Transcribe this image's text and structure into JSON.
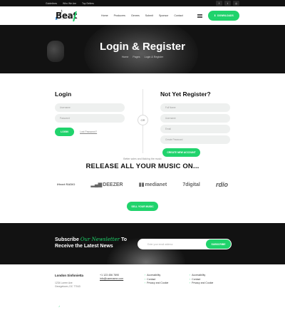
{
  "topbar": {
    "links": [
      "Guidelines",
      "Who We Are",
      "Top Sellers"
    ],
    "login_label": "Login or Register",
    "social": [
      "f",
      "t",
      "◎"
    ]
  },
  "header": {
    "logo_text": "Beat",
    "logo_note": "♪",
    "nav": [
      "Home",
      "Producers",
      "Genres",
      "Submit",
      "Sponsor",
      "Contact"
    ],
    "cta_label": "DOWNLOADS"
  },
  "hero": {
    "title": "Login & Register",
    "crumbs": [
      "Home",
      "Pages",
      "Login & Register"
    ]
  },
  "login": {
    "heading": "Login",
    "username_placeholder": "Username",
    "password_placeholder": "Password",
    "button": "LOGIN",
    "forgot": "Lost Password?"
  },
  "divider": {
    "or": "OR"
  },
  "register": {
    "heading": "Not Yet Register?",
    "fields": [
      "Full Name",
      "Username",
      "Email",
      "Create Password"
    ],
    "button": "CREATE NEW ACCOUNT"
  },
  "release": {
    "kicker": "Better sales and Making the music",
    "title": "RELEASE ALL YOUR MUSIC ON...",
    "brands": [
      "iHeart RADIO",
      "DEEZER",
      "medianet",
      "7digital",
      "rdio"
    ],
    "button": "SELL YOUR MUSIC"
  },
  "newsletter": {
    "line1_prefix": "Subscribe",
    "accent": "Our Newsletter",
    "line1_suffix": "To",
    "line2": "Receive the Latest News",
    "placeholder": "Enter your email address",
    "button": "SUBSCRIBE"
  },
  "footer": {
    "name": "London Sinfonietta",
    "address_lines": [
      "1234 Lorem Ave",
      "Georgetown, DC 77043"
    ],
    "phone": "+1 123 456 7890",
    "email": "info@username.com",
    "col3": [
      "Accessibility",
      "Contact",
      "Privacy and Cookie"
    ],
    "col4": [
      "Accessibility",
      "Contact",
      "Privacy and Cookie"
    ],
    "bottom_mark": "♪"
  }
}
